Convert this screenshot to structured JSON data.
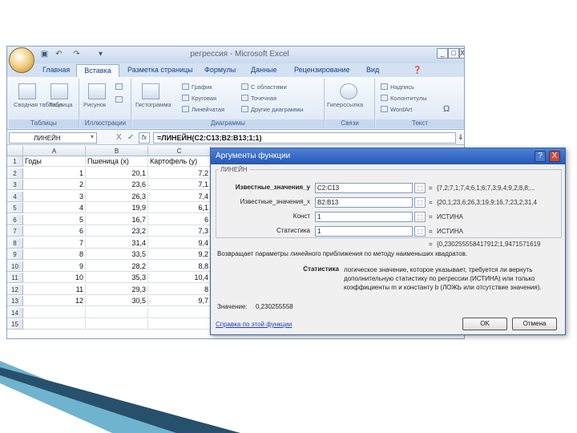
{
  "window": {
    "title": "регрессия - Microsoft Excel",
    "controls": [
      "_",
      "□",
      "X"
    ]
  },
  "tabs": [
    "Главная",
    "Вставка",
    "Разметка страницы",
    "Формулы",
    "Данные",
    "Рецензирование",
    "Вид"
  ],
  "ribbon": {
    "groups": [
      {
        "title": "Таблицы",
        "items": [
          "Сводная таблица",
          "Таблица"
        ]
      },
      {
        "title": "Иллюстрации",
        "items": [
          "Рисунок"
        ]
      },
      {
        "title": "Диаграммы",
        "items": [
          "Гистограмма",
          "График",
          "Круговая",
          "Линейчатая",
          "С областями",
          "Точечная",
          "Другие диаграммы"
        ]
      },
      {
        "title": "Связи",
        "items": [
          "Гиперссылка"
        ]
      },
      {
        "title": "Текст",
        "items": [
          "Надпись",
          "Колонтитулы",
          "WordArt",
          "Ω"
        ]
      }
    ]
  },
  "formula_bar": {
    "name_box": "ЛИНЕЙН",
    "symbols": [
      "▾",
      "X",
      "✓"
    ],
    "fx": "fx",
    "formula": "=ЛИНЕЙН(C2:C13;B2:B13;1;1)"
  },
  "sheet": {
    "columns": [
      "A",
      "B",
      "C"
    ],
    "rows": [
      {
        "num": "1",
        "a": "Годы",
        "b": "Пшеница (x)",
        "c": "Картофель (y)"
      },
      {
        "num": "2",
        "a": "1",
        "b": "20,1",
        "c": "7,2"
      },
      {
        "num": "3",
        "a": "2",
        "b": "23,6",
        "c": "7,1"
      },
      {
        "num": "4",
        "a": "3",
        "b": "26,3",
        "c": "7,4"
      },
      {
        "num": "5",
        "a": "4",
        "b": "19,9",
        "c": "6,1"
      },
      {
        "num": "6",
        "a": "5",
        "b": "16,7",
        "c": "6"
      },
      {
        "num": "7",
        "a": "6",
        "b": "23,2",
        "c": "7,3"
      },
      {
        "num": "8",
        "a": "7",
        "b": "31,4",
        "c": "9,4"
      },
      {
        "num": "9",
        "a": "8",
        "b": "33,5",
        "c": "9,2"
      },
      {
        "num": "10",
        "a": "9",
        "b": "28,2",
        "c": "8,8"
      },
      {
        "num": "11",
        "a": "10",
        "b": "35,3",
        "c": "10,4"
      },
      {
        "num": "12",
        "a": "11",
        "b": "29,3",
        "c": "8"
      },
      {
        "num": "13",
        "a": "12",
        "b": "30,5",
        "c": "9,7"
      },
      {
        "num": "14",
        "a": "",
        "b": "",
        "c": ""
      },
      {
        "num": "15",
        "a": "",
        "b": "",
        "c": ""
      }
    ]
  },
  "dialog": {
    "title": "Аргументы функции",
    "function_name": "ЛИНЕЙН",
    "args": [
      {
        "label": "Известные_значения_y",
        "value": "C2:C13",
        "result": "{7,2;7,1;7,4;6,1;6;7,3;9,4;9,2;8,8;..."
      },
      {
        "label": "Известные_значения_x",
        "value": "B2:B13",
        "result": "{20,1;23,6;26,3;19,9;16,7;23,2;31,4"
      },
      {
        "label": "Конст",
        "value": "1",
        "result": "ИСТИНА"
      },
      {
        "label": "Статистика",
        "value": "1",
        "result": "ИСТИНА"
      }
    ],
    "total_result": "{0,230255558417912;1,9471571619",
    "description": "Возвращает параметры линейного приближения по методу наименьших квадратов.",
    "param_name": "Статистика",
    "param_desc": "логическое значение, которое указывает, требуется ли вернуть дополнительную статистику по регрессии (ИСТИНА) или только коэффициенты m и константу b (ЛОЖЬ или отсутствие значения).",
    "value_label": "Значение:",
    "value": "0,230255558",
    "help_link": "Справка по этой функции",
    "ok": "OK",
    "cancel": "Отмена",
    "help_btn": "?",
    "close_btn": "X"
  },
  "colors": {
    "slide_stripe_dark": "#26506b",
    "slide_stripe_light": "#6fb3cf",
    "excel_blue": "#15428b"
  }
}
